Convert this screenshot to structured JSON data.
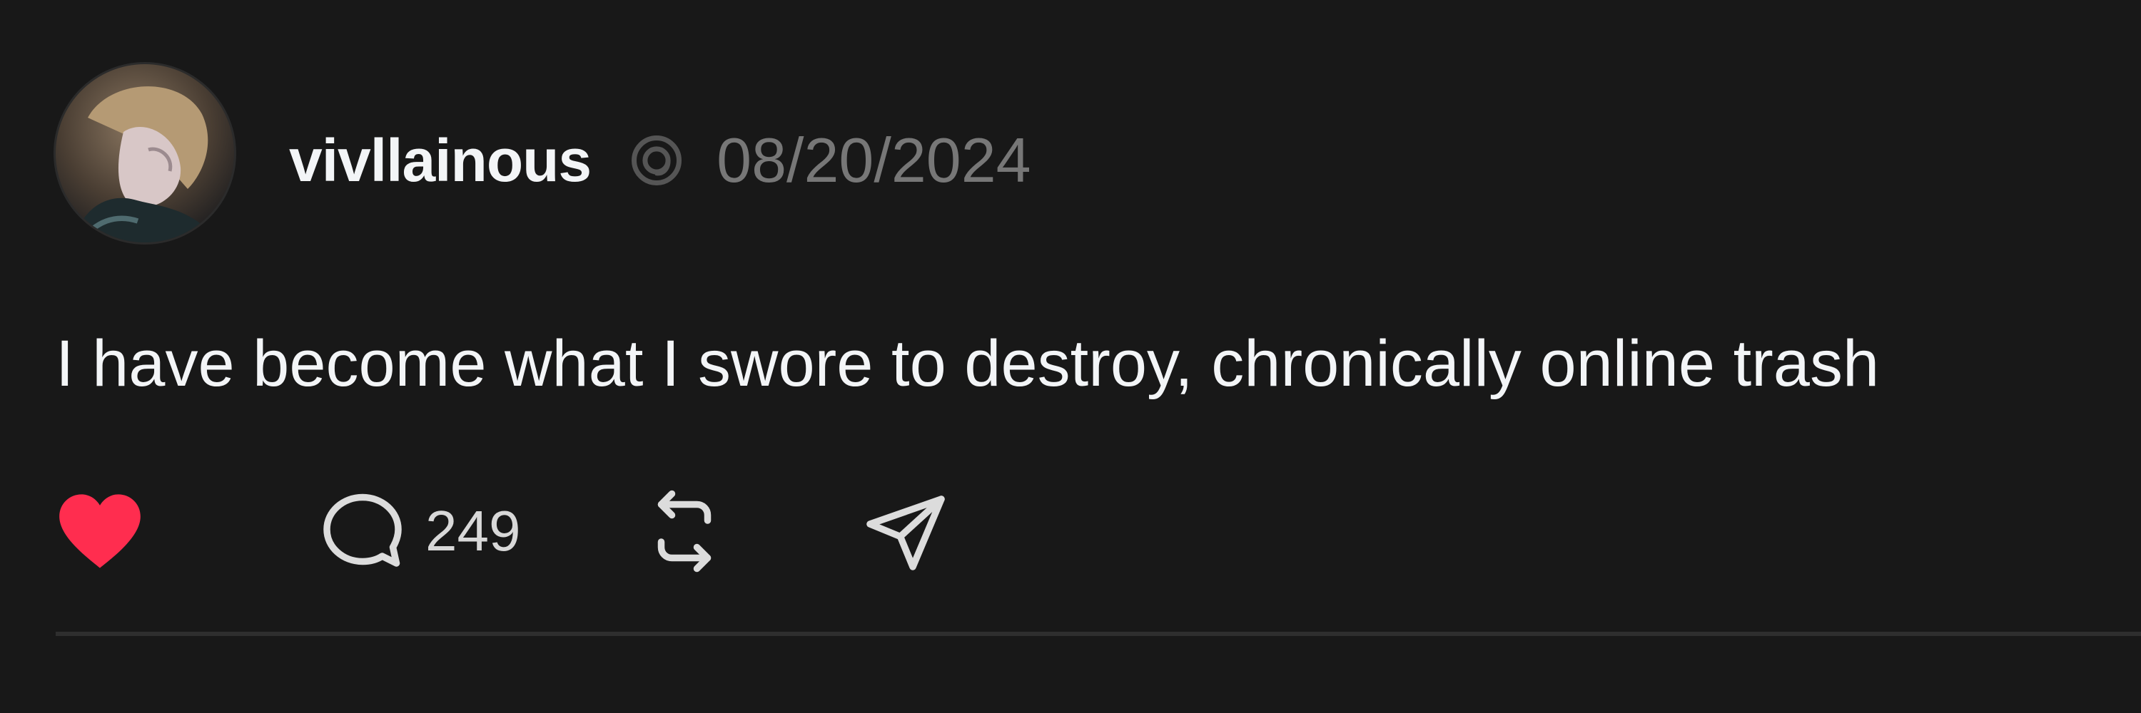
{
  "post": {
    "username": "vivllainous",
    "timestamp": "08/20/2024",
    "text": "I have become what I swore to destroy, chronically online trash",
    "comment_count": "249",
    "liked": true
  },
  "icons": {
    "avatar": "profile-photo",
    "platform": "threads-icon",
    "like": "heart-icon",
    "comment": "comment-bubble-icon",
    "repost": "repost-icon",
    "share": "send-icon"
  },
  "colors": {
    "background": "#181818",
    "text_primary": "#f3f5f7",
    "text_muted": "#777777",
    "like_active": "#ff2d4f",
    "divider": "#2e2e2e"
  }
}
